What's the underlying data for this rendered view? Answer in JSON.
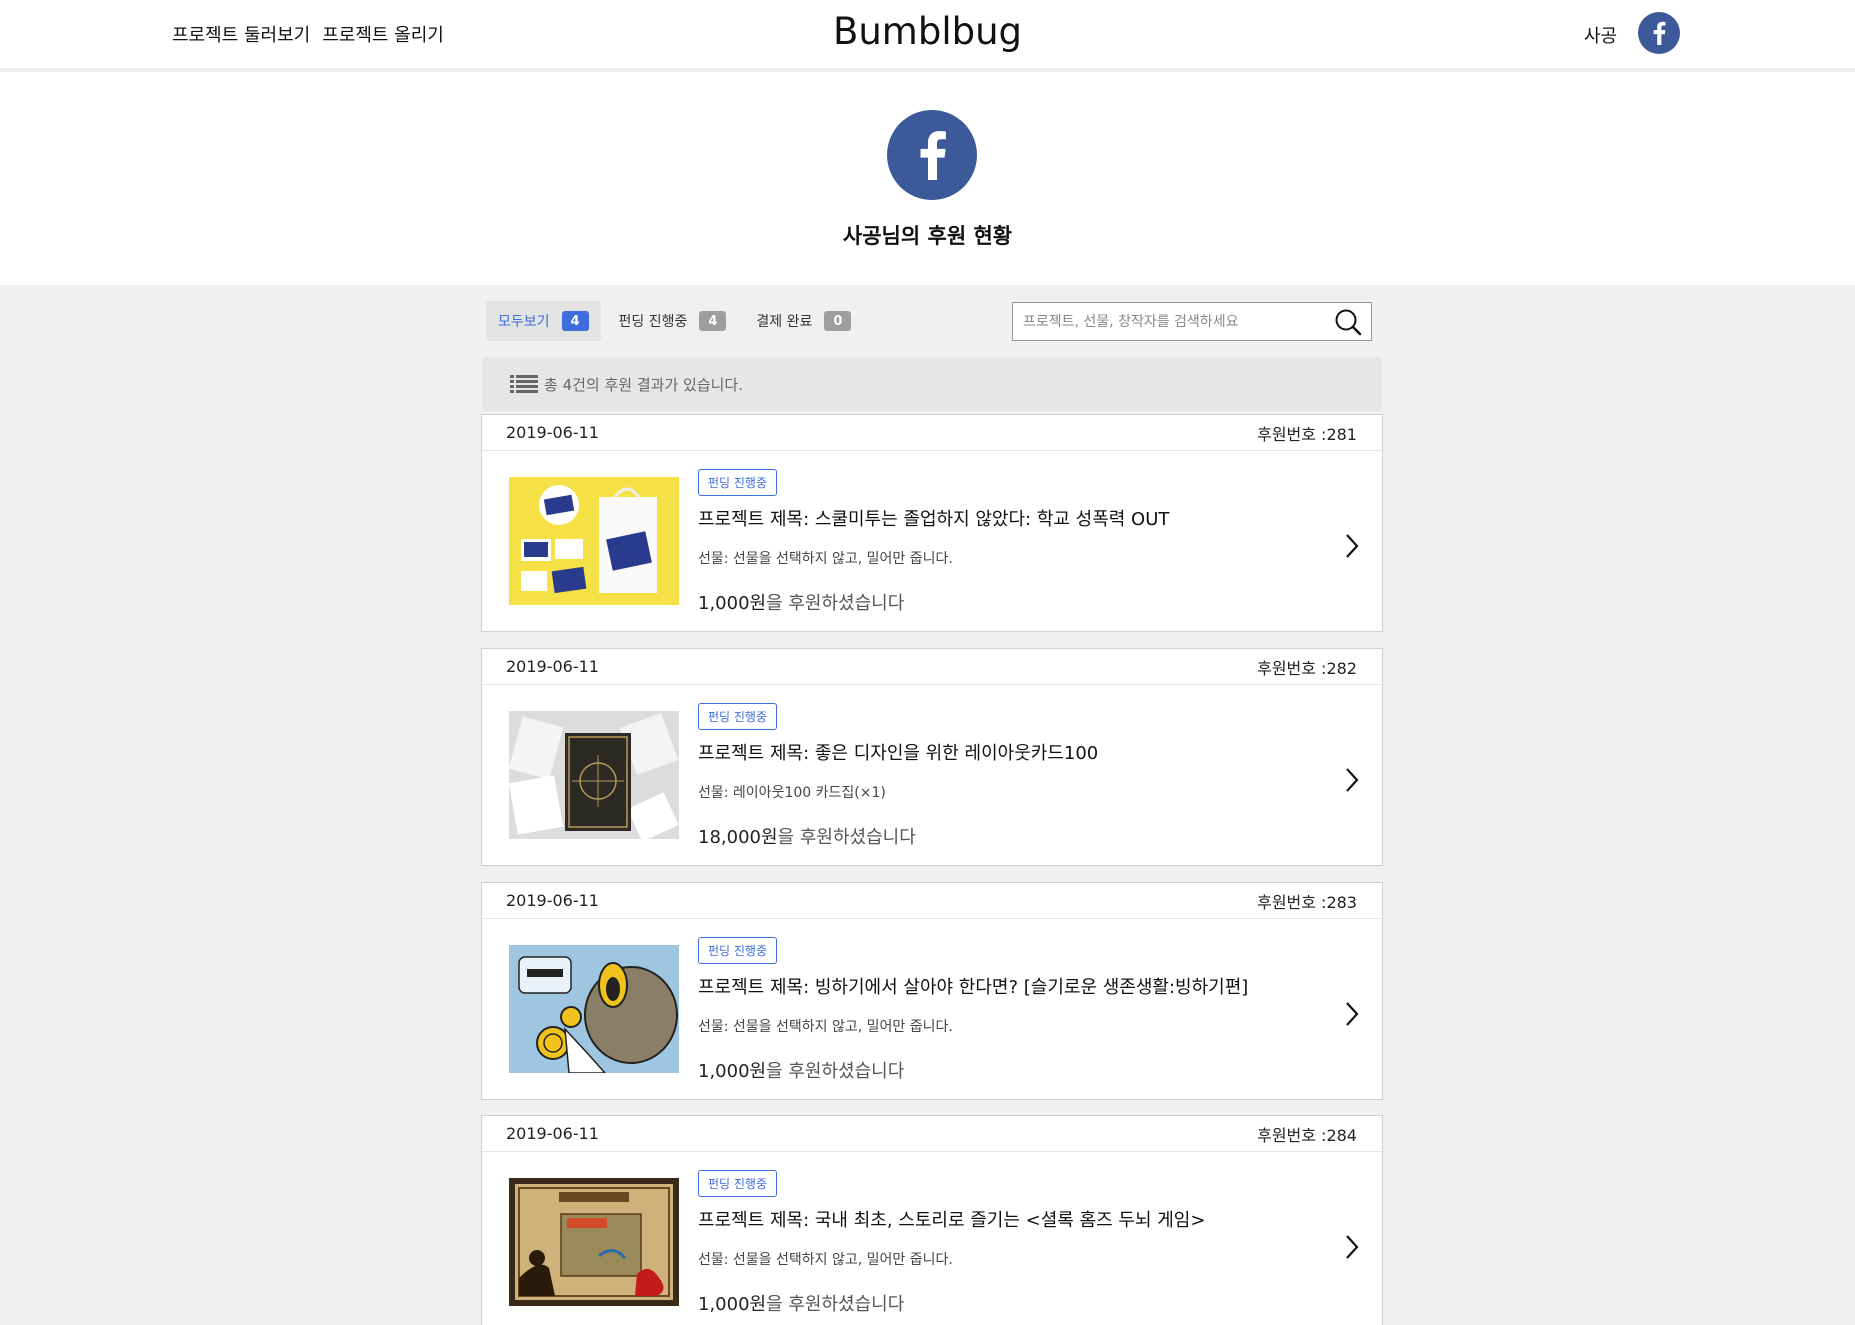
{
  "header": {
    "nav": [
      "프로젝트 둘러보기",
      "프로젝트 올리기"
    ],
    "brand": "Bumblbug",
    "user_name": "사공",
    "avatar_icon": "facebook-icon"
  },
  "profile": {
    "avatar_icon": "facebook-icon",
    "title": "사공님의 후원 현황"
  },
  "filters": [
    {
      "label": "모두보기",
      "count": "4"
    },
    {
      "label": "펀딩 진행중",
      "count": "4"
    },
    {
      "label": "결제 완료",
      "count": "0"
    }
  ],
  "search": {
    "placeholder": "프로젝트, 선물, 창작자를 검색하세요",
    "icon": "search-icon"
  },
  "summary": {
    "icon": "list-icon",
    "text": "총 4건의 후원 결과가 있습니다."
  },
  "colors": {
    "accent": "#3f6ddd",
    "facebook": "#3c5a99",
    "page_bg": "#f0f0f0"
  },
  "pledges": [
    {
      "date": "2019-06-11",
      "number": "후원번호 :281",
      "status": "펀딩 진행중",
      "title": "프로젝트 제목: 스쿨미투는 졸업하지 않았다: 학교 성폭력 OUT",
      "gift": "선물: 선물을 선택하지 않고, 밀어만 줍니다.",
      "amount": "1,000원",
      "amount_suffix": "을 후원하셨습니다"
    },
    {
      "date": "2019-06-11",
      "number": "후원번호 :282",
      "status": "펀딩 진행중",
      "title": "프로젝트 제목: 좋은 디자인을 위한 레이아웃카드100",
      "gift": "선물: 레이아웃100 카드집(×1)",
      "amount": "18,000원",
      "amount_suffix": "을 후원하셨습니다"
    },
    {
      "date": "2019-06-11",
      "number": "후원번호 :283",
      "status": "펀딩 진행중",
      "title": "프로젝트 제목: 빙하기에서 살아야 한다면? [슬기로운 생존생활:빙하기편]",
      "gift": "선물: 선물을 선택하지 않고, 밀어만 줍니다.",
      "amount": "1,000원",
      "amount_suffix": "을 후원하셨습니다"
    },
    {
      "date": "2019-06-11",
      "number": "후원번호 :284",
      "status": "펀딩 진행중",
      "title": "프로젝트 제목: 국내 최초, 스토리로 즐기는 <셜록 홈즈 두뇌 게임>",
      "gift": "선물: 선물을 선택하지 않고, 밀어만 줍니다.",
      "amount": "1,000원",
      "amount_suffix": "을 후원하셨습니다"
    }
  ]
}
